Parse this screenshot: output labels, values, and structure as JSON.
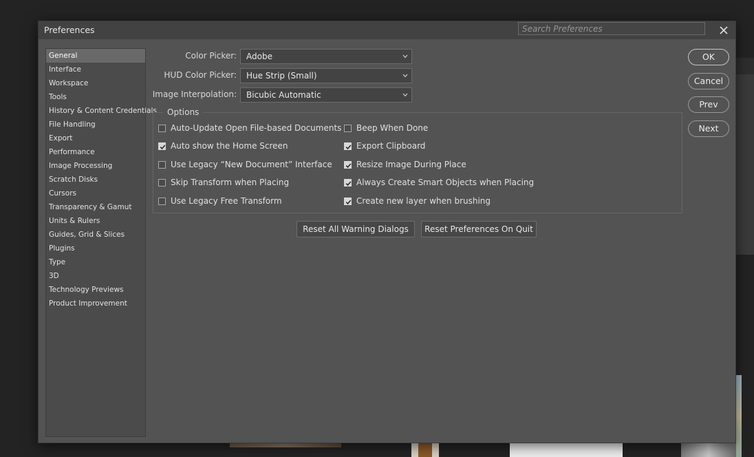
{
  "dialog": {
    "title": "Preferences",
    "search_placeholder": "Search Preferences"
  },
  "sidebar": {
    "items": [
      {
        "label": "General",
        "active": true
      },
      {
        "label": "Interface"
      },
      {
        "label": "Workspace"
      },
      {
        "label": "Tools"
      },
      {
        "label": "History & Content Credentials"
      },
      {
        "label": "File Handling"
      },
      {
        "label": "Export"
      },
      {
        "label": "Performance"
      },
      {
        "label": "Image Processing"
      },
      {
        "label": "Scratch Disks"
      },
      {
        "label": "Cursors"
      },
      {
        "label": "Transparency & Gamut"
      },
      {
        "label": "Units & Rulers"
      },
      {
        "label": "Guides, Grid & Slices"
      },
      {
        "label": "Plugins"
      },
      {
        "label": "Type"
      },
      {
        "label": "3D"
      },
      {
        "label": "Technology Previews"
      },
      {
        "label": "Product Improvement"
      }
    ]
  },
  "fields": {
    "color_picker": {
      "label": "Color Picker:",
      "value": "Adobe"
    },
    "hud_color_picker": {
      "label": "HUD Color Picker:",
      "value": "Hue Strip (Small)"
    },
    "image_interpolation": {
      "label": "Image Interpolation:",
      "value": "Bicubic Automatic"
    }
  },
  "options": {
    "legend": "Options",
    "left": [
      {
        "label": "Auto-Update Open File-based Documents",
        "checked": false
      },
      {
        "label": "Auto show the Home Screen",
        "checked": true
      },
      {
        "label": "Use Legacy “New Document” Interface",
        "checked": false
      },
      {
        "label": "Skip Transform when Placing",
        "checked": false
      },
      {
        "label": "Use Legacy Free Transform",
        "checked": false
      }
    ],
    "right": [
      {
        "label": "Beep When Done",
        "checked": false
      },
      {
        "label": "Export Clipboard",
        "checked": true
      },
      {
        "label": "Resize Image During Place",
        "checked": true
      },
      {
        "label": "Always Create Smart Objects when Placing",
        "checked": true
      },
      {
        "label": "Create new layer when brushing",
        "checked": true
      }
    ]
  },
  "buttons": {
    "reset_warnings": "Reset All Warning Dialogs",
    "reset_prefs": "Reset Preferences On Quit",
    "ok": "OK",
    "cancel": "Cancel",
    "prev": "Prev",
    "next": "Next"
  },
  "icons": {
    "close": "close-icon",
    "dropdown": "chevron-down-icon",
    "check": "checkmark-icon"
  }
}
